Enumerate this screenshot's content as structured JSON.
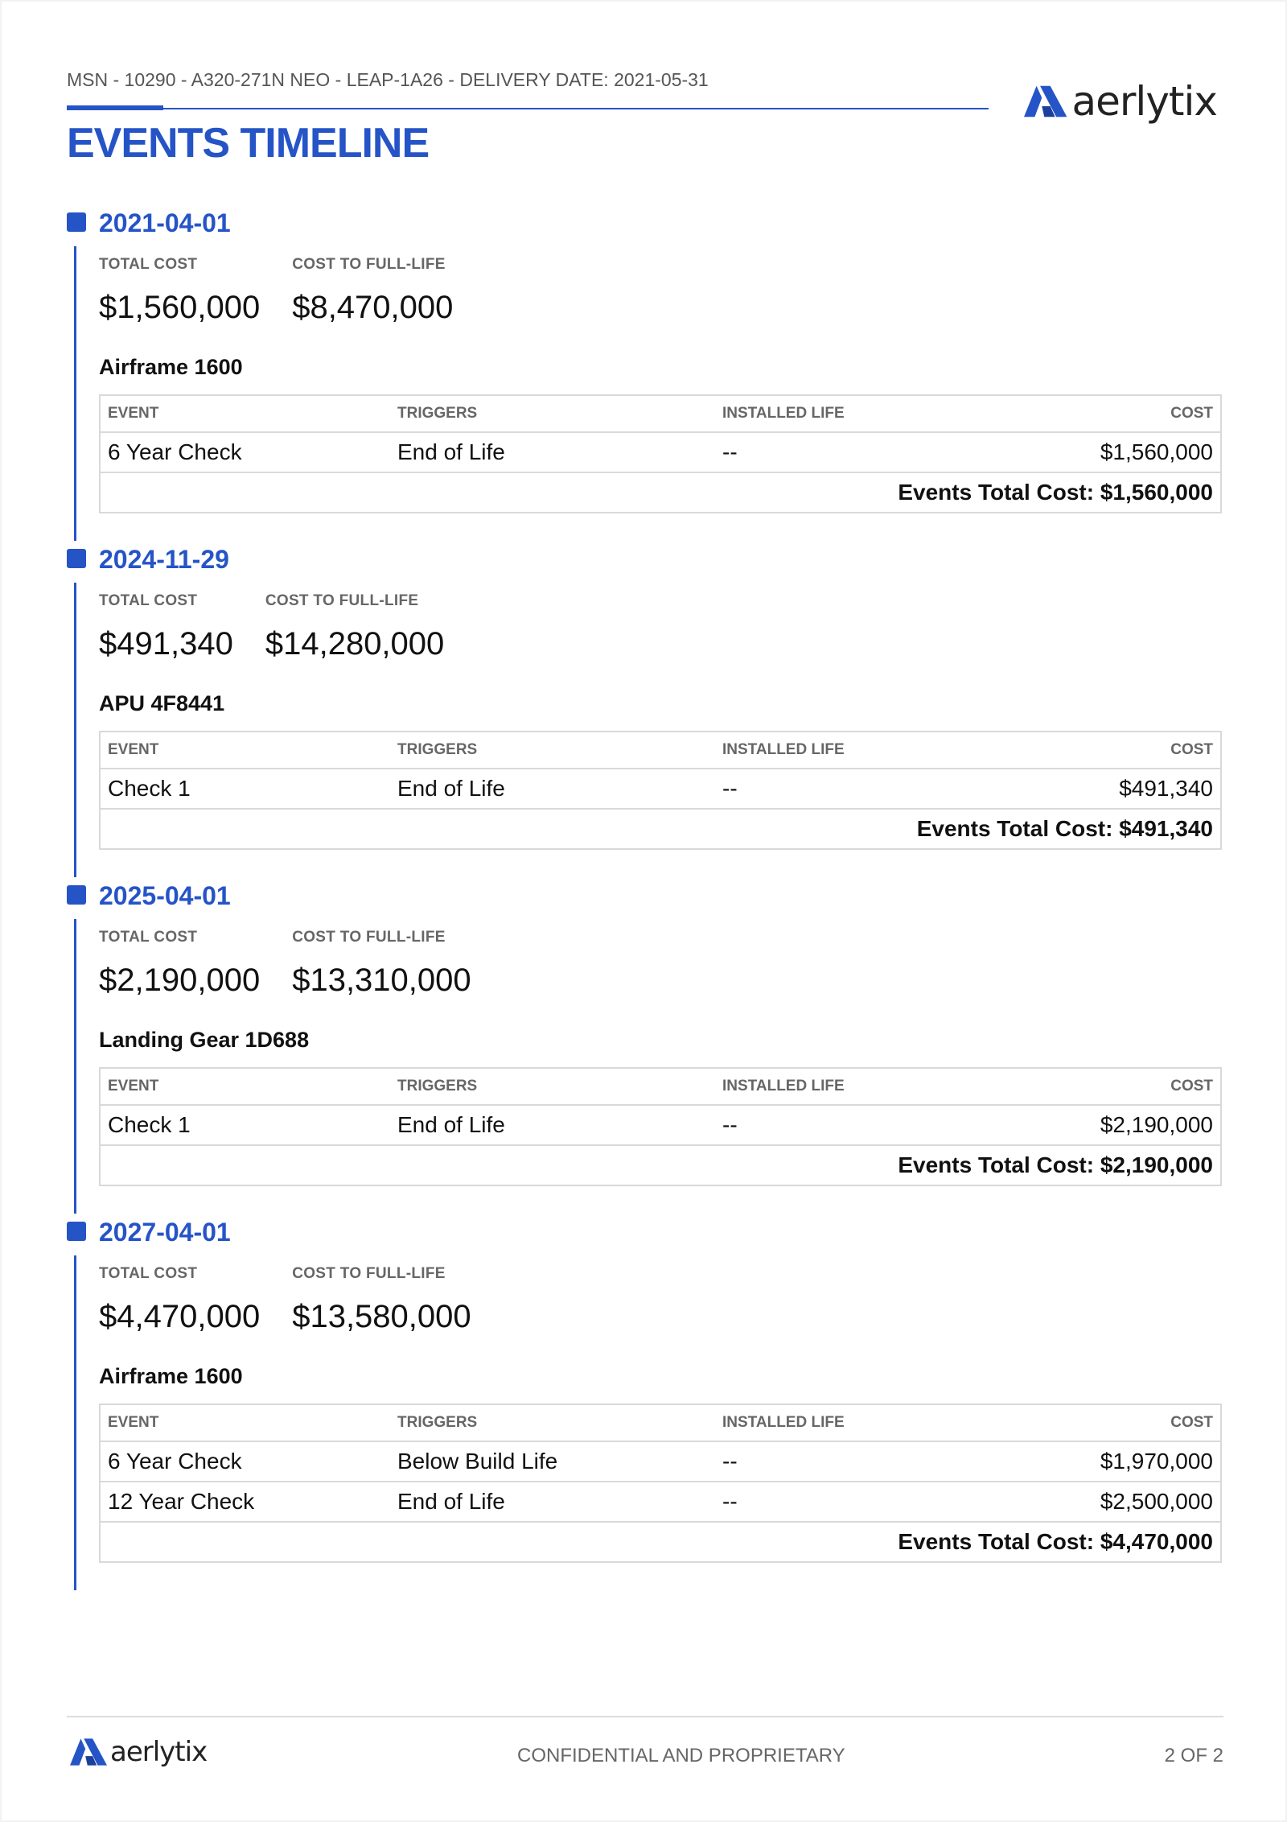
{
  "header": {
    "subtitle": "MSN - 10290 - A320-271N NEO - LEAP-1A26 - DELIVERY DATE: 2021-05-31",
    "title": "EVENTS TIMELINE",
    "logo_text": "aerlytix",
    "brand_color": "#2554c7"
  },
  "labels": {
    "total_cost": "TOTAL COST",
    "cost_to_full_life": "COST TO FULL-LIFE",
    "col_event": "EVENT",
    "col_triggers": "TRIGGERS",
    "col_installed_life": "INSTALLED LIFE",
    "col_cost": "COST"
  },
  "events": [
    {
      "date": "2021-04-01",
      "total_cost": "$1,560,000",
      "cost_to_full_life": "$8,470,000",
      "component": "Airframe 1600",
      "rows": [
        {
          "event": "6 Year Check",
          "triggers": "End of Life",
          "installed_life": "--",
          "cost": "$1,560,000"
        }
      ],
      "events_total": "Events Total Cost: $1,560,000"
    },
    {
      "date": "2024-11-29",
      "total_cost": "$491,340",
      "cost_to_full_life": "$14,280,000",
      "component": "APU 4F8441",
      "rows": [
        {
          "event": "Check 1",
          "triggers": "End of Life",
          "installed_life": "--",
          "cost": "$491,340"
        }
      ],
      "events_total": "Events Total Cost: $491,340"
    },
    {
      "date": "2025-04-01",
      "total_cost": "$2,190,000",
      "cost_to_full_life": "$13,310,000",
      "component": "Landing Gear 1D688",
      "rows": [
        {
          "event": "Check 1",
          "triggers": "End of Life",
          "installed_life": "--",
          "cost": "$2,190,000"
        }
      ],
      "events_total": "Events Total Cost: $2,190,000"
    },
    {
      "date": "2027-04-01",
      "total_cost": "$4,470,000",
      "cost_to_full_life": "$13,580,000",
      "component": "Airframe 1600",
      "rows": [
        {
          "event": "6 Year Check",
          "triggers": "Below Build Life",
          "installed_life": "--",
          "cost": "$1,970,000"
        },
        {
          "event": "12 Year Check",
          "triggers": "End of Life",
          "installed_life": "--",
          "cost": "$2,500,000"
        }
      ],
      "events_total": "Events Total Cost: $4,470,000"
    }
  ],
  "footer": {
    "logo_text": "aerlytix",
    "center": "CONFIDENTIAL AND PROPRIETARY",
    "page": "2 OF 2"
  }
}
